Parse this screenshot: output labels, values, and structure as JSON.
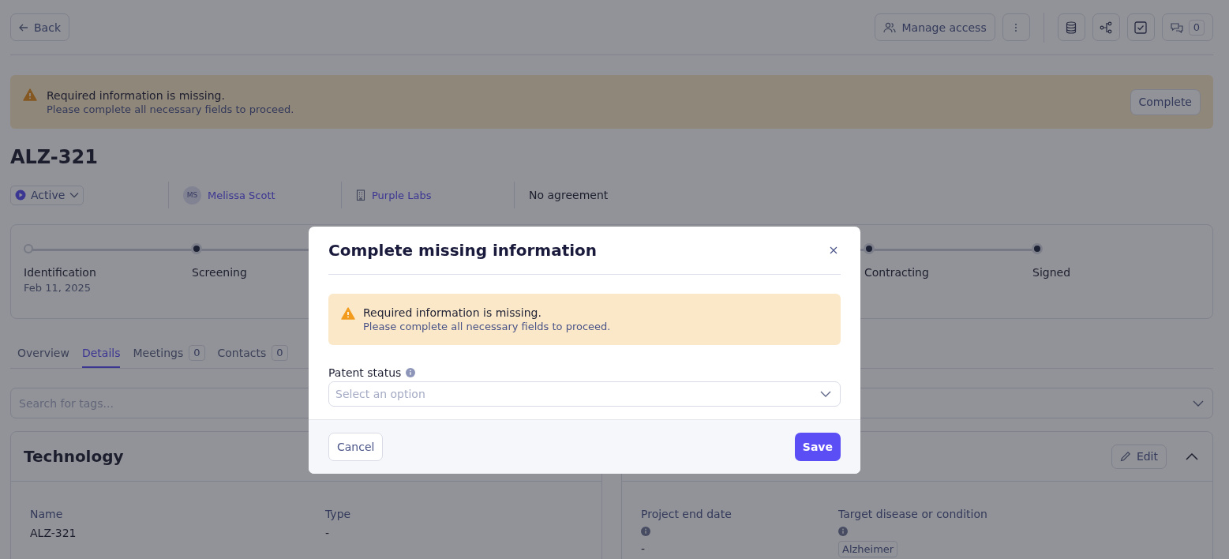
{
  "top_bar": {
    "back": "Back",
    "manage_access": "Manage access",
    "comments_count": "0"
  },
  "banner": {
    "title": "Required information is missing.",
    "message": "Please complete all necessary fields to proceed.",
    "action": "Complete"
  },
  "title": "ALZ-321",
  "meta": {
    "status": "Active",
    "owner_initials": "MS",
    "owner": "Melissa Scott",
    "company": "Purple Labs",
    "agreement": "No agreement"
  },
  "stages": [
    {
      "label": "Identification",
      "date": "Feb 11, 2025",
      "done": true
    },
    {
      "label": "Screening",
      "done": false
    },
    {
      "label": "Contracting",
      "done": false
    },
    {
      "label": "Signed",
      "done": false
    }
  ],
  "tabs": [
    {
      "label": "Overview",
      "selected": false
    },
    {
      "label": "Details",
      "selected": true
    },
    {
      "label": "Meetings",
      "count": "0",
      "selected": false
    },
    {
      "label": "Contacts",
      "count": "0",
      "selected": false
    }
  ],
  "tag_search": {
    "placeholder": "Search for tags..."
  },
  "technology_card": {
    "title": "Technology",
    "fields": [
      {
        "label": "Name",
        "value": "ALZ-321"
      },
      {
        "label": "Type",
        "value": "-"
      }
    ]
  },
  "right_card": {
    "edit": "Edit",
    "fields": [
      {
        "label": "Project end date",
        "info": true,
        "value": "-"
      },
      {
        "label": "Target disease or condition",
        "info": true,
        "tags": [
          "Alzheimer"
        ]
      }
    ]
  },
  "modal": {
    "title": "Complete missing information",
    "alert_title": "Required information is missing.",
    "alert_message": "Please complete all necessary fields to proceed.",
    "field_label": "Patent status",
    "field_placeholder": "Select an option",
    "cancel": "Cancel",
    "save": "Save"
  }
}
